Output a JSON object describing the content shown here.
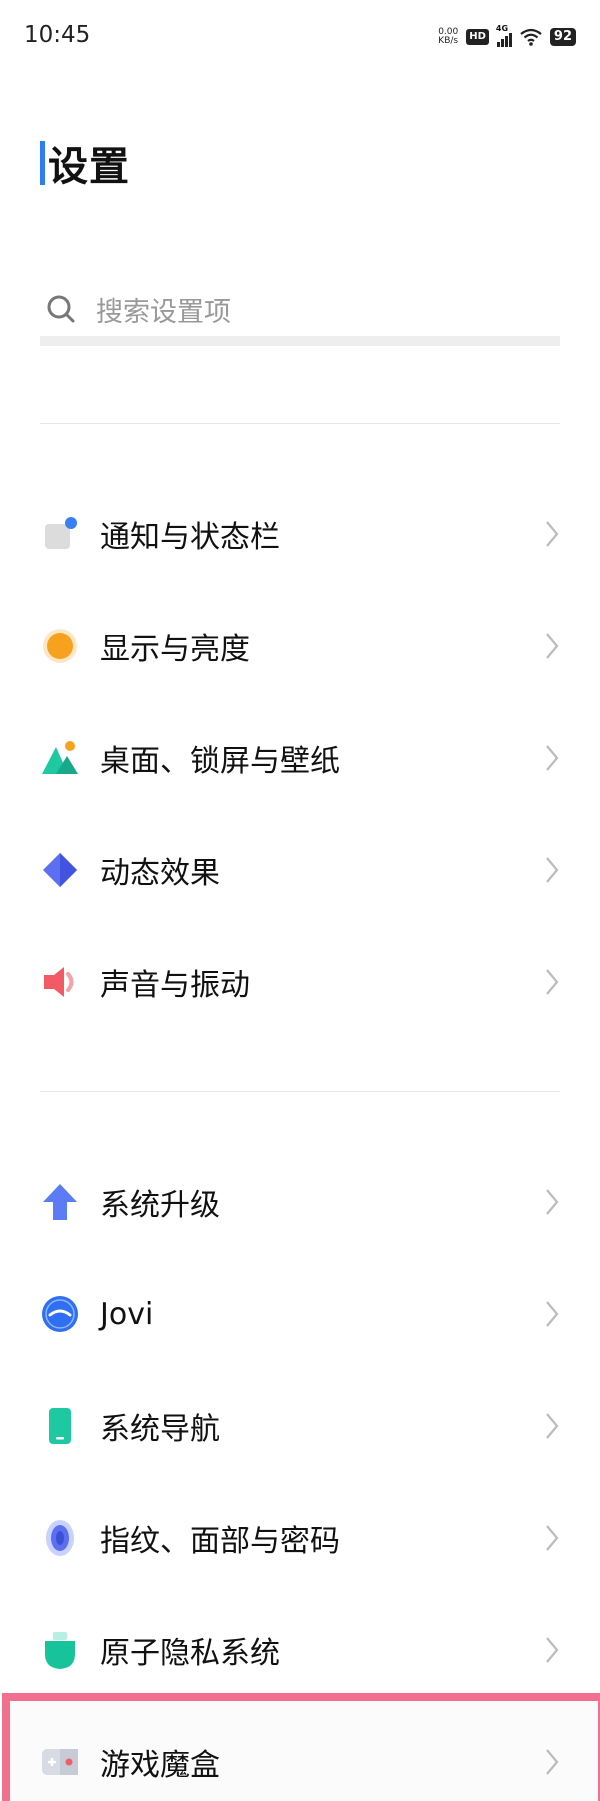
{
  "status_bar": {
    "time": "10:45",
    "net_speed_value": "0.00",
    "net_speed_unit": "KB/s",
    "hd_badge": "HD",
    "network_type": "4G",
    "battery": "92"
  },
  "header": {
    "title": "设置"
  },
  "search": {
    "placeholder": "搜索设置项"
  },
  "settings_groups": [
    {
      "items": [
        {
          "label": "通知与状态栏",
          "icon": "notification-icon"
        },
        {
          "label": "显示与亮度",
          "icon": "display-brightness-icon"
        },
        {
          "label": "桌面、锁屏与壁纸",
          "icon": "wallpaper-icon"
        },
        {
          "label": "动态效果",
          "icon": "animation-icon"
        },
        {
          "label": "声音与振动",
          "icon": "sound-icon"
        }
      ]
    },
    {
      "items": [
        {
          "label": "系统升级",
          "icon": "system-update-icon"
        },
        {
          "label": "Jovi",
          "icon": "jovi-icon"
        },
        {
          "label": "系统导航",
          "icon": "system-navigation-icon"
        },
        {
          "label": "指纹、面部与密码",
          "icon": "fingerprint-icon"
        },
        {
          "label": "原子隐私系统",
          "icon": "privacy-shield-icon"
        },
        {
          "label": "游戏魔盒",
          "icon": "game-box-icon"
        }
      ]
    }
  ],
  "colors": {
    "title_accent": "#2e7cf6",
    "highlight_border": "#f2708f"
  }
}
